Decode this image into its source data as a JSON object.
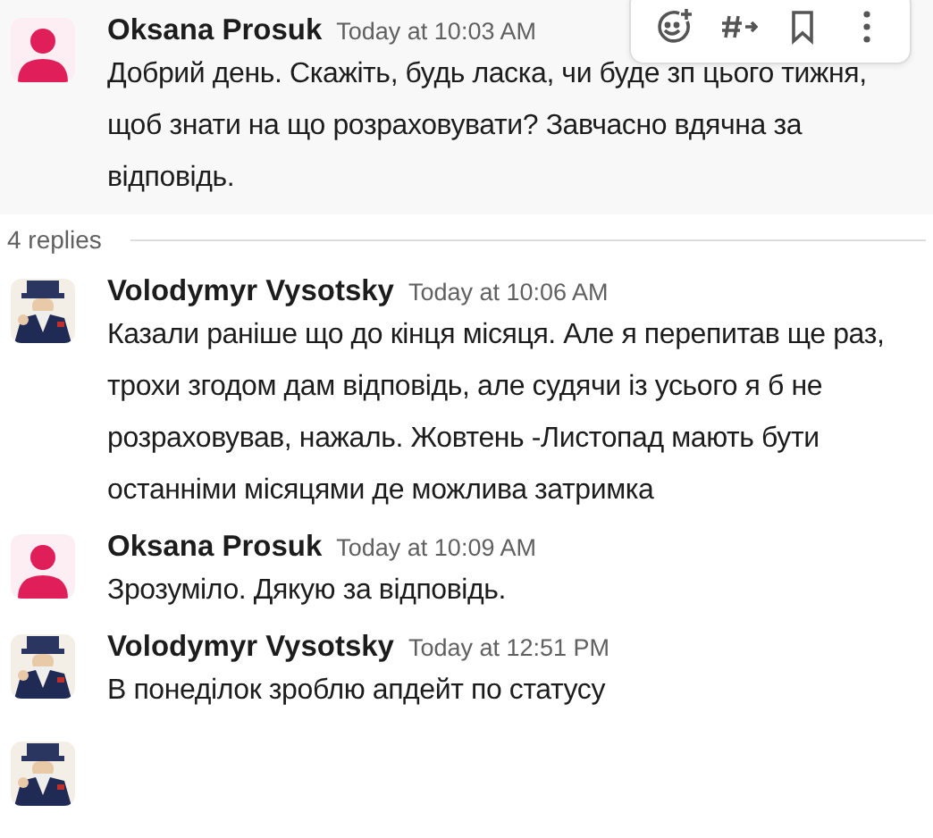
{
  "thread": [
    {
      "kind": "message",
      "author": "Oksana Prosuk",
      "time": "Today at 10:03 AM",
      "text": "Добрий день. Скажіть, будь ласка, чи буде зп цього тижня, щоб знати на що розраховувати? Завчасно вдячна за відповідь.",
      "avatar": {
        "kind": "person"
      },
      "hovered": true
    },
    {
      "kind": "replies",
      "count": "4 replies"
    },
    {
      "kind": "message",
      "author": "Volodymyr Vysotsky",
      "time": "Today at 10:06 AM",
      "text": "Казали раніше що до кінця місяця. Але я перепитав ще раз, трохи згодом дам відповідь, але судячи із усього я б не розраховував, нажаль. Жовтень -Листопад мають бути останніми місяцями де можлива затримка",
      "hovered": false
    },
    {
      "kind": "message",
      "author": "Oksana Prosuk",
      "time": "Today at 10:09 AM",
      "text": "Зрозуміло. Дякую за відповідь.",
      "avatar": {
        "kind": "person"
      },
      "hovered": false
    },
    {
      "kind": "message",
      "author": "Volodymyr Vysotsky",
      "time": "Today at 12:51 PM",
      "text": "В понеділок зроблю апдейт по статусу",
      "hovered": false
    },
    {
      "kind": "cut"
    }
  ]
}
